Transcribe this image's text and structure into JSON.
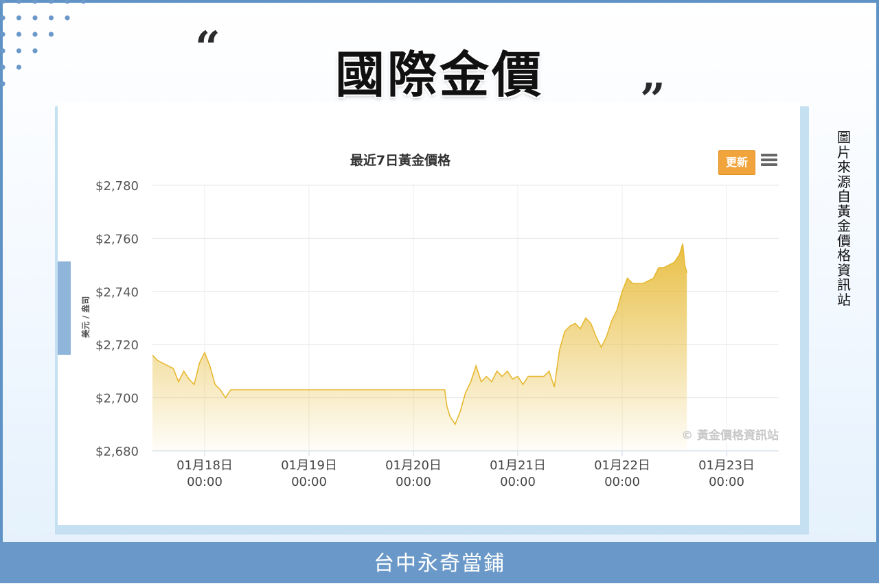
{
  "page": {
    "title": "國際金價",
    "quote_open": "“",
    "quote_close": "”",
    "side_caption": "圖片來源自黃金價格資訊站",
    "footer": "台中永奇當鋪"
  },
  "chart_toolbar": {
    "update_label": "更新",
    "menu_icon": "hamburger-menu-icon"
  },
  "colors": {
    "frame": "#5f93c6",
    "footer": "#6a98c8",
    "gold_line": "#e6b830",
    "update_button": "#f2a43c"
  },
  "chart_data": {
    "type": "area",
    "title": "最近7日黃金價格",
    "ylabel": "美元 / 盎司",
    "xlabel": "",
    "watermark": "© 黃金價格資訊站",
    "x_axis": {
      "type": "datetime",
      "range_days": [
        17.5,
        23.5
      ],
      "ticks": [
        {
          "day": 18,
          "label": "01月18日",
          "sub": "00:00"
        },
        {
          "day": 19,
          "label": "01月19日",
          "sub": "00:00"
        },
        {
          "day": 20,
          "label": "01月20日",
          "sub": "00:00"
        },
        {
          "day": 21,
          "label": "01月21日",
          "sub": "00:00"
        },
        {
          "day": 22,
          "label": "01月22日",
          "sub": "00:00"
        },
        {
          "day": 23,
          "label": "01月23日",
          "sub": "00:00"
        }
      ]
    },
    "y_axis": {
      "ylim": [
        2680,
        2780
      ],
      "ticks": [
        {
          "value": 2680,
          "label": "$2,680"
        },
        {
          "value": 2700,
          "label": "$2,700"
        },
        {
          "value": 2720,
          "label": "$2,720"
        },
        {
          "value": 2740,
          "label": "$2,740"
        },
        {
          "value": 2760,
          "label": "$2,760"
        },
        {
          "value": 2780,
          "label": "$2,780"
        }
      ]
    },
    "grid": true,
    "series": [
      {
        "points": [
          [
            17.5,
            2716
          ],
          [
            17.55,
            2714
          ],
          [
            17.6,
            2713
          ],
          [
            17.65,
            2712
          ],
          [
            17.7,
            2711
          ],
          [
            17.75,
            2706
          ],
          [
            17.8,
            2710
          ],
          [
            17.85,
            2707
          ],
          [
            17.9,
            2705
          ],
          [
            17.95,
            2713
          ],
          [
            18.0,
            2717
          ],
          [
            18.05,
            2712
          ],
          [
            18.1,
            2705
          ],
          [
            18.15,
            2703
          ],
          [
            18.2,
            2700
          ],
          [
            18.25,
            2703
          ],
          [
            18.5,
            2703
          ],
          [
            19.0,
            2703
          ],
          [
            19.5,
            2703
          ],
          [
            20.0,
            2703
          ],
          [
            20.3,
            2703
          ],
          [
            20.32,
            2697
          ],
          [
            20.35,
            2693
          ],
          [
            20.4,
            2690
          ],
          [
            20.45,
            2695
          ],
          [
            20.5,
            2702
          ],
          [
            20.55,
            2706
          ],
          [
            20.6,
            2712
          ],
          [
            20.65,
            2706
          ],
          [
            20.7,
            2708
          ],
          [
            20.75,
            2706
          ],
          [
            20.8,
            2710
          ],
          [
            20.85,
            2708
          ],
          [
            20.9,
            2710
          ],
          [
            20.95,
            2707
          ],
          [
            21.0,
            2708
          ],
          [
            21.05,
            2705
          ],
          [
            21.1,
            2708
          ],
          [
            21.15,
            2708
          ],
          [
            21.2,
            2708
          ],
          [
            21.25,
            2708
          ],
          [
            21.3,
            2710
          ],
          [
            21.35,
            2704
          ],
          [
            21.4,
            2718
          ],
          [
            21.45,
            2725
          ],
          [
            21.5,
            2727
          ],
          [
            21.55,
            2728
          ],
          [
            21.6,
            2726
          ],
          [
            21.65,
            2730
          ],
          [
            21.7,
            2728
          ],
          [
            21.75,
            2723
          ],
          [
            21.8,
            2719
          ],
          [
            21.85,
            2723
          ],
          [
            21.9,
            2729
          ],
          [
            21.95,
            2733
          ],
          [
            22.0,
            2740
          ],
          [
            22.05,
            2745
          ],
          [
            22.1,
            2743
          ],
          [
            22.15,
            2743
          ],
          [
            22.2,
            2743
          ],
          [
            22.25,
            2744
          ],
          [
            22.3,
            2745
          ],
          [
            22.35,
            2749
          ],
          [
            22.4,
            2749
          ],
          [
            22.45,
            2750
          ],
          [
            22.5,
            2751
          ],
          [
            22.55,
            2754
          ],
          [
            22.58,
            2758
          ],
          [
            22.6,
            2750
          ],
          [
            22.62,
            2747
          ]
        ]
      }
    ]
  }
}
